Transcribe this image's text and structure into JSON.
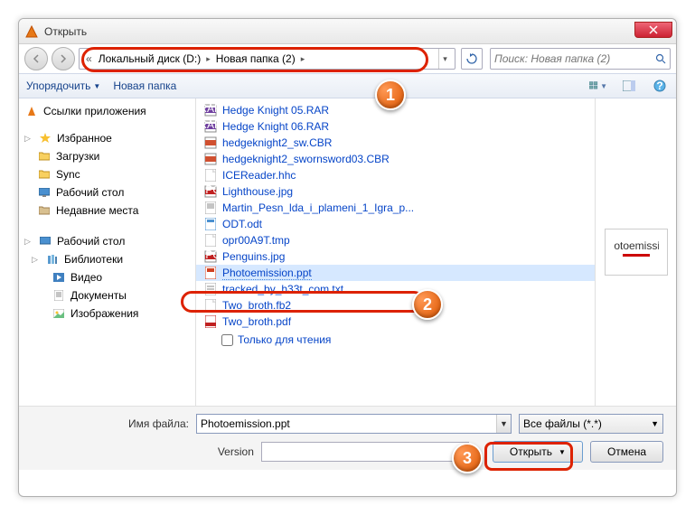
{
  "window": {
    "title": "Открыть"
  },
  "breadcrumb": {
    "parts": [
      "Локальный диск (D:)",
      "Новая папка (2)"
    ]
  },
  "search": {
    "placeholder": "Поиск: Новая папка (2)"
  },
  "toolbar": {
    "organize": "Упорядочить",
    "new_folder": "Новая папка"
  },
  "sidebar": {
    "app_links": "Ссылки приложения",
    "favorites": "Избранное",
    "fav_items": [
      "Загрузки",
      "Sync",
      "Рабочий стол",
      "Недавние места"
    ],
    "desktop": "Рабочий стол",
    "libraries": "Библиотеки",
    "lib_items": [
      "Видео",
      "Документы",
      "Изображения"
    ]
  },
  "files": [
    {
      "name": "Hedge Knight 05.RAR",
      "icon": "rar"
    },
    {
      "name": "Hedge Knight 06.RAR",
      "icon": "rar"
    },
    {
      "name": "hedgeknight2_sw.CBR",
      "icon": "cbr"
    },
    {
      "name": "hedgeknight2_swornsword03.CBR",
      "icon": "cbr"
    },
    {
      "name": "ICEReader.hhc",
      "icon": "generic"
    },
    {
      "name": "Lighthouse.jpg",
      "icon": "jpg"
    },
    {
      "name": "Martin_Pesn_lda_i_plameni_1_Igra_p...",
      "icon": "doc"
    },
    {
      "name": "ODT.odt",
      "icon": "odt"
    },
    {
      "name": "opr00A9T.tmp",
      "icon": "generic"
    },
    {
      "name": "Penguins.jpg",
      "icon": "jpg"
    },
    {
      "name": "Photoemission.ppt",
      "icon": "ppt",
      "selected": true
    },
    {
      "name": "tracked_by_h33t_com.txt",
      "icon": "txt"
    },
    {
      "name": "Two_broth.fb2",
      "icon": "generic"
    },
    {
      "name": "Two_broth.pdf",
      "icon": "pdf"
    }
  ],
  "readonly_label": "Только для чтения",
  "filename_label": "Имя файла:",
  "filename_value": "Photoemission.ppt",
  "filetype_value": "Все файлы (*.*)",
  "version_label": "Version",
  "open_btn": "Открыть",
  "cancel_btn": "Отмена",
  "badges": {
    "b1": "1",
    "b2": "2",
    "b3": "3"
  }
}
